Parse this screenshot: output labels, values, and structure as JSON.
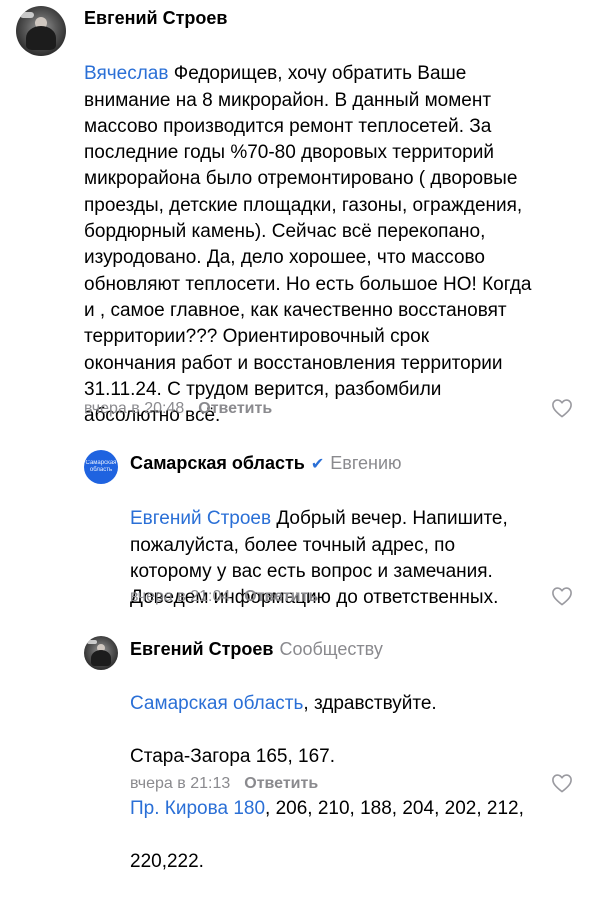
{
  "comments": [
    {
      "author": "Евгений Строев",
      "avatar_icon": "user-photo",
      "mention": "Вячеслав",
      "text": " Федорищев, хочу обратить Ваше\nвнимание на 8 микрорайон. В данный момент\nмассово производится ремонт теплосетей. За\nпоследние годы %70-80 дворовых территорий\nмикрорайона было отремонтировано ( дворовые\nпроезды, детские площадки, газоны, ограждения,\nбордюрный камень). Сейчас всё перекопано,\nизуродовано. Да, дело хорошее, что массово\nобновляют теплосети. Но есть большое НО! Когда\nи , самое главное,  как качественно восстановят\nтерритории???  Ориентировочный срок\nокончания работ и восстановления территории\n31.11.24. С трудом верится, разбомбили\nабсолютно всё.",
      "time": "вчера в 20:48",
      "reply_label": "Ответить",
      "like_icon": "heart-outline"
    },
    {
      "author": "Самарская область",
      "avatar_icon": "samara-region-logo",
      "avatar_text": "Самарская\nобласть",
      "verified_icon": "✔",
      "reply_to": "Евгению",
      "mention": "Евгений Строев",
      "text": " Добрый вечер. Напишите,\nпожалуйста, более точный адрес, по\nкоторому у вас есть вопрос и замечания.\nДоведем информацию до ответственных.",
      "time": "вчера в 21:04",
      "reply_label": "Ответить",
      "like_icon": "heart-outline"
    },
    {
      "author": "Евгений Строев",
      "avatar_icon": "user-photo",
      "reply_to": "Сообществу",
      "mention": "Самарская область",
      "text_line1": ", здравствуйте.",
      "text_line2": "Стара-Загора 165, 167.",
      "mention2": "Пр. Кирова 180",
      "text_line3": ", 206, 210,  188, 204, 202, 212,",
      "text_line4": "220,222.",
      "time": "вчера в 21:13",
      "reply_label": "Ответить",
      "like_icon": "heart-outline"
    }
  ],
  "colors": {
    "link": "#2a6fd6",
    "meta": "#8a8a8e",
    "logo_bg": "#1f63e0"
  }
}
